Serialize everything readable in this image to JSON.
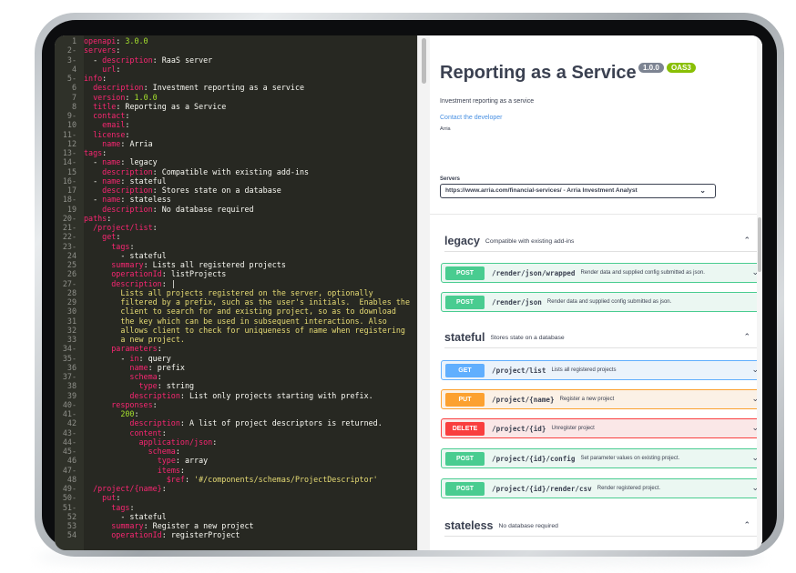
{
  "editor": {
    "lines": [
      {
        "n": "1",
        "f": "",
        "t": [
          [
            "k",
            "openapi"
          ],
          [
            "v",
            ": "
          ],
          [
            "c",
            "3.0.0"
          ]
        ]
      },
      {
        "n": "2",
        "f": "-",
        "t": [
          [
            "k",
            "servers"
          ],
          [
            "v",
            ":"
          ]
        ]
      },
      {
        "n": "3",
        "f": "-",
        "t": [
          [
            "v",
            "  - "
          ],
          [
            "k",
            "description"
          ],
          [
            "v",
            ": "
          ],
          [
            "v",
            "RaaS server"
          ]
        ]
      },
      {
        "n": "4",
        "f": "",
        "t": [
          [
            "v",
            "    "
          ],
          [
            "k",
            "url"
          ],
          [
            "v",
            ":"
          ]
        ]
      },
      {
        "n": "5",
        "f": "-",
        "t": [
          [
            "k",
            "info"
          ],
          [
            "v",
            ":"
          ]
        ]
      },
      {
        "n": "6",
        "f": "",
        "t": [
          [
            "v",
            "  "
          ],
          [
            "k",
            "description"
          ],
          [
            "v",
            ": "
          ],
          [
            "v",
            "Investment reporting as a service"
          ]
        ]
      },
      {
        "n": "7",
        "f": "",
        "t": [
          [
            "v",
            "  "
          ],
          [
            "k",
            "version"
          ],
          [
            "v",
            ": "
          ],
          [
            "c",
            "1.0.0"
          ]
        ]
      },
      {
        "n": "8",
        "f": "",
        "t": [
          [
            "v",
            "  "
          ],
          [
            "k",
            "title"
          ],
          [
            "v",
            ": "
          ],
          [
            "v",
            "Reporting as a Service"
          ]
        ]
      },
      {
        "n": "9",
        "f": "-",
        "t": [
          [
            "v",
            "  "
          ],
          [
            "k",
            "contact"
          ],
          [
            "v",
            ":"
          ]
        ]
      },
      {
        "n": "10",
        "f": "",
        "t": [
          [
            "v",
            "    "
          ],
          [
            "k",
            "email"
          ],
          [
            "v",
            ":"
          ]
        ]
      },
      {
        "n": "11",
        "f": "-",
        "t": [
          [
            "v",
            "  "
          ],
          [
            "k",
            "license"
          ],
          [
            "v",
            ":"
          ]
        ]
      },
      {
        "n": "12",
        "f": "",
        "t": [
          [
            "v",
            "    "
          ],
          [
            "k",
            "name"
          ],
          [
            "v",
            ": "
          ],
          [
            "v",
            "Arria"
          ]
        ]
      },
      {
        "n": "13",
        "f": "-",
        "t": [
          [
            "k",
            "tags"
          ],
          [
            "v",
            ":"
          ]
        ]
      },
      {
        "n": "14",
        "f": "-",
        "t": [
          [
            "v",
            "  - "
          ],
          [
            "k",
            "name"
          ],
          [
            "v",
            ": "
          ],
          [
            "v",
            "legacy"
          ]
        ]
      },
      {
        "n": "15",
        "f": "",
        "t": [
          [
            "v",
            "    "
          ],
          [
            "k",
            "description"
          ],
          [
            "v",
            ": "
          ],
          [
            "v",
            "Compatible with existing add-ins"
          ]
        ]
      },
      {
        "n": "16",
        "f": "-",
        "t": [
          [
            "v",
            "  - "
          ],
          [
            "k",
            "name"
          ],
          [
            "v",
            ": "
          ],
          [
            "v",
            "stateful"
          ]
        ]
      },
      {
        "n": "17",
        "f": "",
        "t": [
          [
            "v",
            "    "
          ],
          [
            "k",
            "description"
          ],
          [
            "v",
            ": "
          ],
          [
            "v",
            "Stores state on a database"
          ]
        ]
      },
      {
        "n": "18",
        "f": "-",
        "t": [
          [
            "v",
            "  - "
          ],
          [
            "k",
            "name"
          ],
          [
            "v",
            ": "
          ],
          [
            "v",
            "stateless"
          ]
        ]
      },
      {
        "n": "19",
        "f": "",
        "t": [
          [
            "v",
            "    "
          ],
          [
            "k",
            "description"
          ],
          [
            "v",
            ": "
          ],
          [
            "v",
            "No database required"
          ]
        ]
      },
      {
        "n": "20",
        "f": "-",
        "t": [
          [
            "k",
            "paths"
          ],
          [
            "v",
            ":"
          ]
        ]
      },
      {
        "n": "21",
        "f": "-",
        "t": [
          [
            "v",
            "  "
          ],
          [
            "k",
            "/project/list"
          ],
          [
            "v",
            ":"
          ]
        ]
      },
      {
        "n": "22",
        "f": "-",
        "t": [
          [
            "v",
            "    "
          ],
          [
            "k",
            "get"
          ],
          [
            "v",
            ":"
          ]
        ]
      },
      {
        "n": "23",
        "f": "-",
        "t": [
          [
            "v",
            "      "
          ],
          [
            "k",
            "tags"
          ],
          [
            "v",
            ":"
          ]
        ]
      },
      {
        "n": "24",
        "f": "",
        "t": [
          [
            "v",
            "        - "
          ],
          [
            "v",
            "stateful"
          ]
        ]
      },
      {
        "n": "25",
        "f": "",
        "t": [
          [
            "v",
            "      "
          ],
          [
            "k",
            "summary"
          ],
          [
            "v",
            ": "
          ],
          [
            "v",
            "Lists all registered projects"
          ]
        ]
      },
      {
        "n": "26",
        "f": "",
        "t": [
          [
            "v",
            "      "
          ],
          [
            "k",
            "operationId"
          ],
          [
            "v",
            ": "
          ],
          [
            "v",
            "listProjects"
          ]
        ]
      },
      {
        "n": "27",
        "f": "-",
        "t": [
          [
            "v",
            "      "
          ],
          [
            "k",
            "description"
          ],
          [
            "v",
            ": "
          ],
          [
            "v",
            "|"
          ]
        ]
      },
      {
        "n": "28",
        "f": "",
        "t": [
          [
            "s",
            "        Lists all projects registered on the server, optionally"
          ]
        ]
      },
      {
        "n": "29",
        "f": "",
        "t": [
          [
            "s",
            "        filtered by a prefix, such as the user's initials.  Enables the"
          ]
        ]
      },
      {
        "n": "30",
        "f": "",
        "t": [
          [
            "s",
            "        client to search for and existing project, so as to download"
          ]
        ]
      },
      {
        "n": "31",
        "f": "",
        "t": [
          [
            "s",
            "        the key which can be used in subsequent interactions. Also"
          ]
        ]
      },
      {
        "n": "32",
        "f": "",
        "t": [
          [
            "s",
            "        allows client to check for uniqueness of name when registering"
          ]
        ]
      },
      {
        "n": "33",
        "f": "",
        "t": [
          [
            "s",
            "        a new project."
          ]
        ]
      },
      {
        "n": "34",
        "f": "-",
        "t": [
          [
            "v",
            "      "
          ],
          [
            "k",
            "parameters"
          ],
          [
            "v",
            ":"
          ]
        ]
      },
      {
        "n": "35",
        "f": "-",
        "t": [
          [
            "v",
            "        - "
          ],
          [
            "k",
            "in"
          ],
          [
            "v",
            ": "
          ],
          [
            "v",
            "query"
          ]
        ]
      },
      {
        "n": "36",
        "f": "",
        "t": [
          [
            "v",
            "          "
          ],
          [
            "k",
            "name"
          ],
          [
            "v",
            ": "
          ],
          [
            "v",
            "prefix"
          ]
        ]
      },
      {
        "n": "37",
        "f": "-",
        "t": [
          [
            "v",
            "          "
          ],
          [
            "k",
            "schema"
          ],
          [
            "v",
            ":"
          ]
        ]
      },
      {
        "n": "38",
        "f": "",
        "t": [
          [
            "v",
            "            "
          ],
          [
            "k",
            "type"
          ],
          [
            "v",
            ": "
          ],
          [
            "v",
            "string"
          ]
        ]
      },
      {
        "n": "39",
        "f": "",
        "t": [
          [
            "v",
            "          "
          ],
          [
            "k",
            "description"
          ],
          [
            "v",
            ": "
          ],
          [
            "v",
            "List only projects starting with prefix."
          ]
        ]
      },
      {
        "n": "40",
        "f": "-",
        "t": [
          [
            "v",
            "      "
          ],
          [
            "k",
            "responses"
          ],
          [
            "v",
            ":"
          ]
        ]
      },
      {
        "n": "41",
        "f": "-",
        "t": [
          [
            "v",
            "        "
          ],
          [
            "c",
            "200"
          ],
          [
            "v",
            ":"
          ]
        ]
      },
      {
        "n": "42",
        "f": "",
        "t": [
          [
            "v",
            "          "
          ],
          [
            "k",
            "description"
          ],
          [
            "v",
            ": "
          ],
          [
            "v",
            "A list of project descriptors is returned."
          ]
        ]
      },
      {
        "n": "43",
        "f": "-",
        "t": [
          [
            "v",
            "          "
          ],
          [
            "k",
            "content"
          ],
          [
            "v",
            ":"
          ]
        ]
      },
      {
        "n": "44",
        "f": "-",
        "t": [
          [
            "v",
            "            "
          ],
          [
            "k",
            "application/json"
          ],
          [
            "v",
            ":"
          ]
        ]
      },
      {
        "n": "45",
        "f": "-",
        "t": [
          [
            "v",
            "              "
          ],
          [
            "k",
            "schema"
          ],
          [
            "v",
            ":"
          ]
        ]
      },
      {
        "n": "46",
        "f": "",
        "t": [
          [
            "v",
            "                "
          ],
          [
            "k",
            "type"
          ],
          [
            "v",
            ": "
          ],
          [
            "v",
            "array"
          ]
        ]
      },
      {
        "n": "47",
        "f": "-",
        "t": [
          [
            "v",
            "                "
          ],
          [
            "k",
            "items"
          ],
          [
            "v",
            ":"
          ]
        ]
      },
      {
        "n": "48",
        "f": "",
        "t": [
          [
            "v",
            "                  "
          ],
          [
            "k",
            "$ref"
          ],
          [
            "v",
            ": "
          ],
          [
            "s",
            "'#/components/schemas/ProjectDescriptor'"
          ]
        ]
      },
      {
        "n": "49",
        "f": "-",
        "t": [
          [
            "v",
            "  "
          ],
          [
            "k",
            "/project/{name}"
          ],
          [
            "v",
            ":"
          ]
        ]
      },
      {
        "n": "50",
        "f": "-",
        "t": [
          [
            "v",
            "    "
          ],
          [
            "k",
            "put"
          ],
          [
            "v",
            ":"
          ]
        ]
      },
      {
        "n": "51",
        "f": "-",
        "t": [
          [
            "v",
            "      "
          ],
          [
            "k",
            "tags"
          ],
          [
            "v",
            ":"
          ]
        ]
      },
      {
        "n": "52",
        "f": "",
        "t": [
          [
            "v",
            "        - "
          ],
          [
            "v",
            "stateful"
          ]
        ]
      },
      {
        "n": "53",
        "f": "",
        "t": [
          [
            "v",
            "      "
          ],
          [
            "k",
            "summary"
          ],
          [
            "v",
            ": "
          ],
          [
            "v",
            "Register a new project"
          ]
        ]
      },
      {
        "n": "54",
        "f": "",
        "t": [
          [
            "v",
            "      "
          ],
          [
            "k",
            "operationId"
          ],
          [
            "v",
            ": "
          ],
          [
            "v",
            "registerProject"
          ]
        ]
      }
    ]
  },
  "docs": {
    "title": "Reporting as a Service",
    "version_badge": "1.0.0",
    "oas_badge": "OAS3",
    "description": "Investment reporting as a service",
    "contact_link": "Contact the developer",
    "license": "Arria",
    "servers_label": "Servers",
    "servers_selected": "https://www.arria.com/financial-services/ - Arria Investment Analyst"
  },
  "tags": [
    {
      "name": "legacy",
      "description": "Compatible with existing add-ins"
    },
    {
      "name": "stateful",
      "description": "Stores state on a database"
    },
    {
      "name": "stateless",
      "description": "No database required"
    }
  ],
  "operations": [
    {
      "method": "POST",
      "path": "/render/json/wrapped",
      "summary": "Render data and supplied config submitted as json."
    },
    {
      "method": "POST",
      "path": "/render/json",
      "summary": "Render data and supplied config submitted as json."
    },
    {
      "method": "GET",
      "path": "/project/list",
      "summary": "Lists all registered projects"
    },
    {
      "method": "PUT",
      "path": "/project/{name}",
      "summary": "Register a new project"
    },
    {
      "method": "DELETE",
      "path": "/project/{id}",
      "summary": "Unregister project"
    },
    {
      "method": "POST",
      "path": "/project/{id}/config",
      "summary": "Set parameter values on existing project."
    },
    {
      "method": "POST",
      "path": "/project/{id}/render/csv",
      "summary": "Render registered project."
    }
  ],
  "colors": {
    "post": "#49cc90",
    "get": "#61affe",
    "put": "#fca130",
    "delete": "#f93e3e",
    "editor_bg": "#272822"
  }
}
